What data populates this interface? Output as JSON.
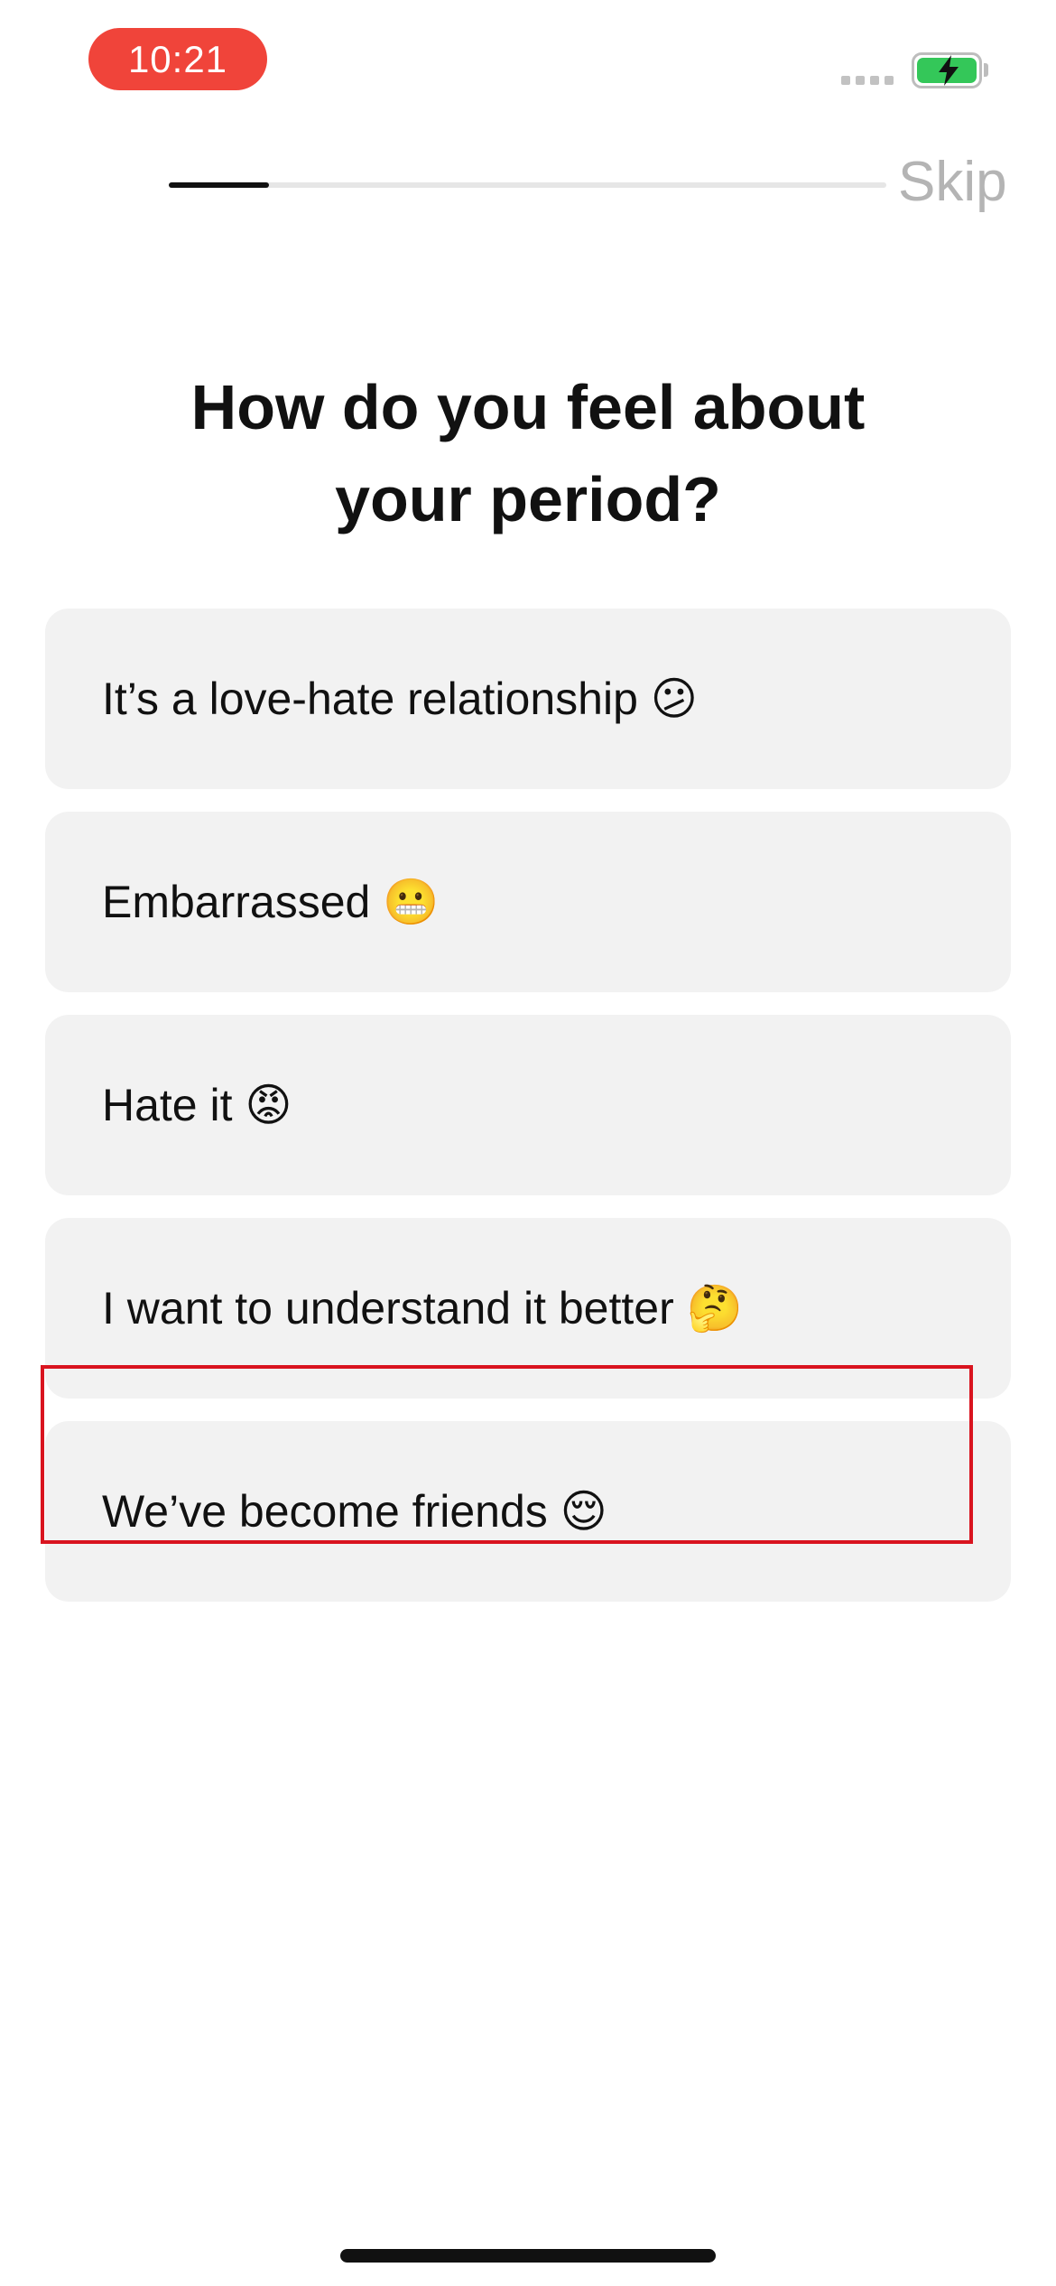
{
  "status_bar": {
    "time": "10:21",
    "battery_state": "charging",
    "battery_color": "#34c759",
    "time_pill_color": "#f0443a"
  },
  "progress": {
    "value": 0.14
  },
  "header": {
    "skip_label": "Skip"
  },
  "question": {
    "title_line1": "How do you feel about",
    "title_line2": "your period?"
  },
  "options": [
    {
      "label": "It’s a love-hate relationship 😕"
    },
    {
      "label": "Embarrassed 😬"
    },
    {
      "label": "Hate it 😡"
    },
    {
      "label": "I want to understand it better 🤔"
    },
    {
      "label": "We’ve become friends 😌"
    }
  ],
  "highlight": {
    "color": "#d9141f",
    "target": "We’ve become friends 😌"
  }
}
